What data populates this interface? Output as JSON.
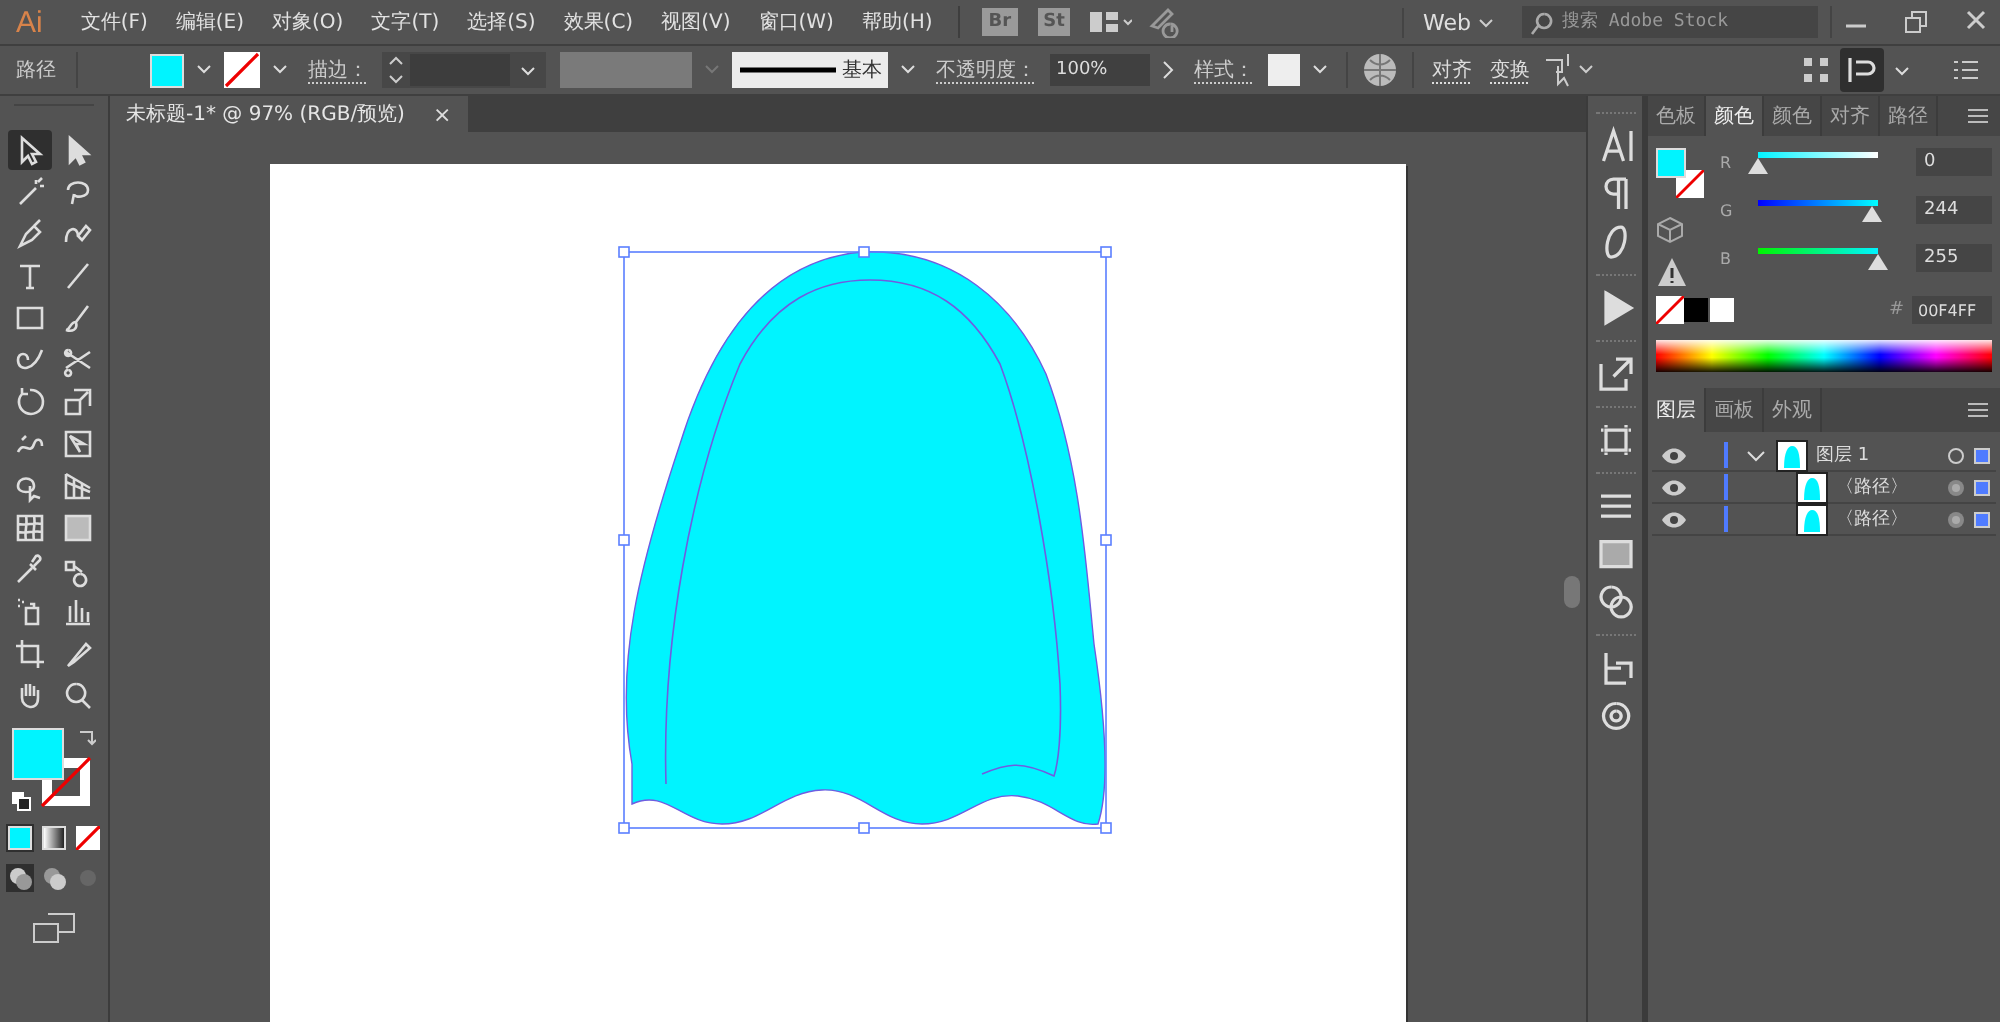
{
  "app": {
    "logo": "Ai",
    "menu": [
      "文件(F)",
      "编辑(E)",
      "对象(O)",
      "文字(T)",
      "选择(S)",
      "效果(C)",
      "视图(V)",
      "窗口(W)",
      "帮助(H)"
    ],
    "bridge": "Br",
    "stock": "St",
    "workspace": "Web",
    "search": {
      "placeholder": "搜索 Adobe Stock"
    }
  },
  "control_bar": {
    "selection": "路径",
    "stroke_label": "描边：",
    "stroke_style": "基本",
    "opacity_label": "不透明度：",
    "opacity": "100%",
    "style_label": "样式：",
    "align": "对齐",
    "transform": "变换"
  },
  "document_tab": {
    "title": "未标题-1* @ 97% (RGB/预览)",
    "close": "×"
  },
  "color_panel": {
    "tabs": [
      {
        "label": "色板",
        "selected": false
      },
      {
        "label": "颜色",
        "selected": true
      },
      {
        "label": "颜色",
        "selected": false
      },
      {
        "label": "对齐",
        "selected": false
      },
      {
        "label": "路径",
        "selected": false
      }
    ],
    "channels": [
      {
        "name": "R",
        "level": 0,
        "value": "0"
      },
      {
        "name": "G",
        "level": 0.957,
        "value": "244"
      },
      {
        "name": "B",
        "level": 1,
        "value": "255"
      }
    ],
    "hash": "#",
    "hex": "00F4FF"
  },
  "layers_panel": {
    "tabs": [
      {
        "label": "图层",
        "selected": true
      },
      {
        "label": "画板",
        "selected": false
      },
      {
        "label": "外观",
        "selected": false
      }
    ],
    "layers": [
      {
        "name": "图层 1",
        "visible": true,
        "expanded": true,
        "children": [
          {
            "name": "〈路径〉",
            "visible": true
          },
          {
            "name": "〈路径〉",
            "visible": true
          }
        ]
      }
    ]
  }
}
